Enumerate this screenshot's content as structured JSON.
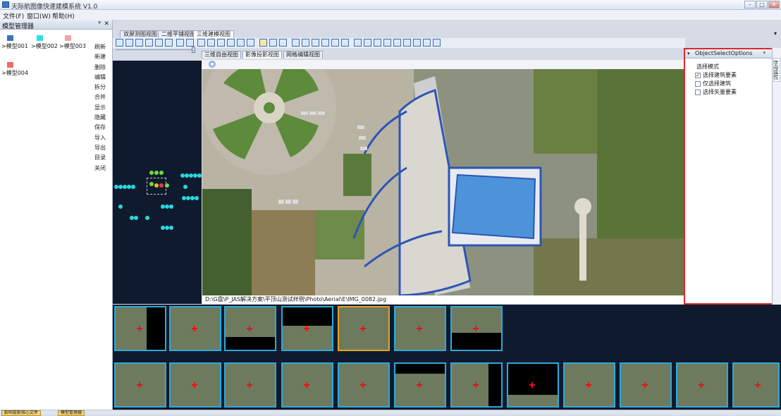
{
  "window": {
    "title": "天际航图像快速建模系统 V1.0",
    "min": "–",
    "max": "□",
    "close": "✕"
  },
  "menu": [
    "文件(F)",
    "窗口(W)",
    "帮助(H)"
  ],
  "model_manager": {
    "title": "模型管理器",
    "pin": "ᵠ",
    "close": "✕",
    "models": [
      {
        "label": ">模型001",
        "color": "#3b6fc2"
      },
      {
        "label": ">模型002",
        "color": "#27e0e8"
      },
      {
        "label": ">模型003",
        "color": "#f5a2a2"
      },
      {
        "label": ">模型004",
        "color": "#f06a6a"
      }
    ],
    "commands": [
      "刷新",
      "新建",
      "删除",
      "编辑",
      "拆分",
      "合并",
      "显示",
      "隐藏",
      "保存",
      "导入",
      "导出",
      "目录",
      "关闭"
    ]
  },
  "doc_tabs": [
    "双屏测图视图",
    "二维平铺视图",
    "三维建模视图"
  ],
  "sub_tabs": [
    "三维自由视图",
    "影像投影视图",
    "网格编辑视图"
  ],
  "image_path": "D:\\G盘\\P_JAS解决方案\\平顶山测试样例\\Photo\\Aerial\\E\\IMG_0082.jpg",
  "object_select": {
    "title": "ObjectSelectOptions",
    "group_label": "选择模式",
    "options": [
      {
        "label": "选择建筑要素",
        "checked": true
      },
      {
        "label": "仅选择建筑",
        "checked": false
      },
      {
        "label": "选择矢量要素",
        "checked": false
      }
    ],
    "side_label": "字母属性"
  },
  "status_tabs": [
    "影响投影核心文件",
    "模型管理器"
  ],
  "colors": {
    "accent": "#3c6fb3",
    "highlight": "#d92a2a",
    "thumb_border": "#2fa9d8",
    "thumb_selected": "#e4a325"
  }
}
